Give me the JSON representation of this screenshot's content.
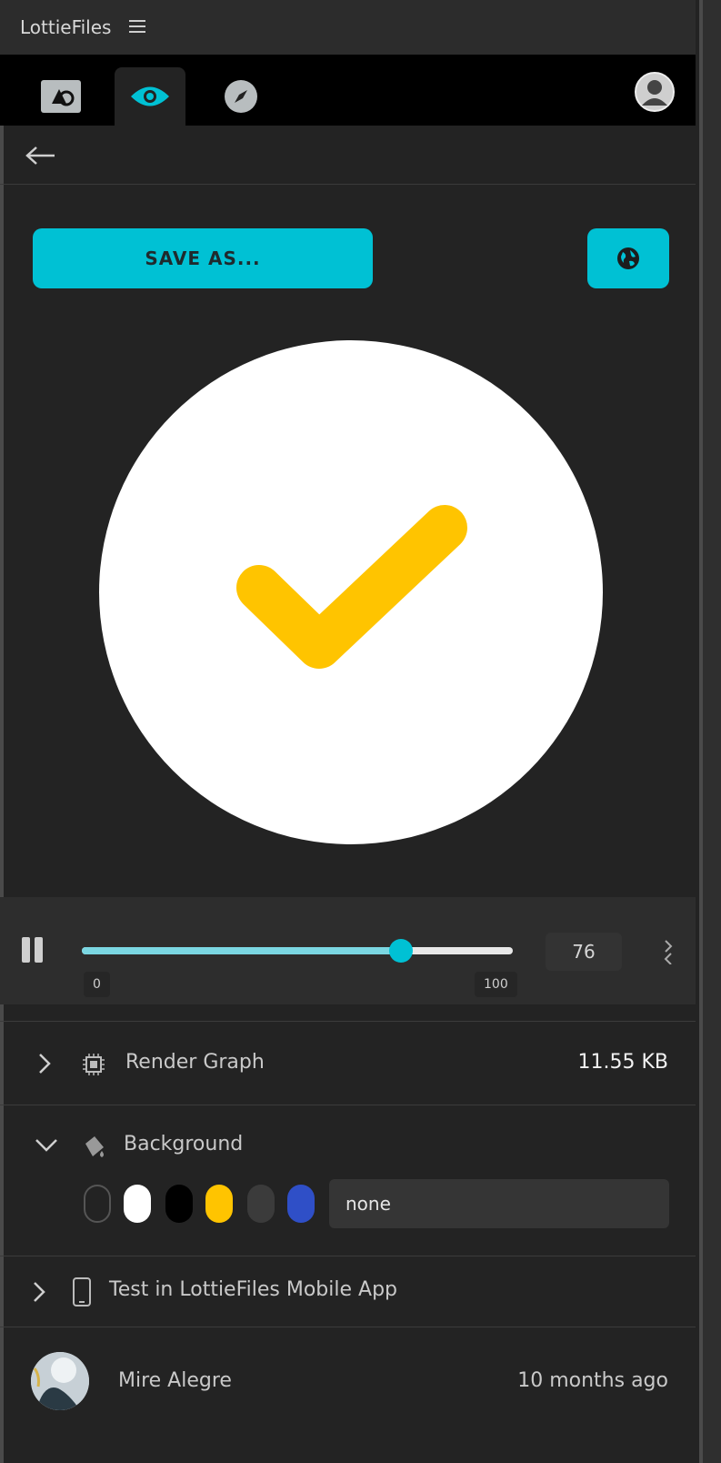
{
  "app": {
    "title": "LottieFiles"
  },
  "actions": {
    "save_label": "SAVE AS..."
  },
  "player": {
    "frame_value": "76",
    "min_label": "0",
    "max_label": "100",
    "progress": 0.74,
    "accent": "#00c1d4"
  },
  "sections": {
    "render_graph": {
      "label": "Render Graph",
      "size": "11.55 KB"
    },
    "background": {
      "label": "Background",
      "swatches": [
        "transparent",
        "#ffffff",
        "#000000",
        "#ffc400",
        "#3b3b3b",
        "#2f4fc7"
      ],
      "value": "none"
    },
    "test_mobile": {
      "label": "Test in LottieFiles Mobile App"
    }
  },
  "author": {
    "name": "Mire Alegre",
    "time": "10 months ago"
  },
  "colors": {
    "accent": "#00c1d4",
    "check": "#ffc400"
  },
  "icons": {
    "tabs": [
      "lottie-logo-icon",
      "eye-icon",
      "compass-icon"
    ],
    "account": "user-avatar-icon"
  }
}
